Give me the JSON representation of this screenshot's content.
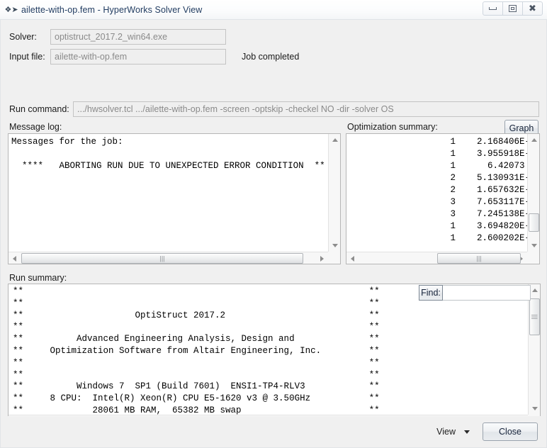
{
  "window": {
    "title": "ailette-with-op.fem - HyperWorks Solver View",
    "icon": "hyperworks-app-icon",
    "buttons": {
      "minimize": "minimize-icon",
      "maximize": "maximize-icon",
      "close": "close-icon"
    }
  },
  "form": {
    "solver_label": "Solver:",
    "solver_value": "optistruct_2017.2_win64.exe",
    "input_label": "Input file:",
    "input_value": "ailette-with-op.fem",
    "job_status": "Job completed",
    "run_command_label": "Run command:",
    "run_command_value": ".../hwsolver.tcl .../ailette-with-op.fem -screen -optskip -checkel NO -dir -solver OS"
  },
  "message_log": {
    "label": "Message log:",
    "text": "Messages for the job:\n\n  ****   ABORTING RUN DUE TO UNEXPECTED ERROR CONDITION  **"
  },
  "optimization_summary": {
    "label": "Optimization summary:",
    "graph_button": "Graph",
    "rows": [
      {
        "index": "1",
        "value": "2.168406E-"
      },
      {
        "index": "1",
        "value": "3.955918E-"
      },
      {
        "index": "1",
        "value": "  6.42073"
      },
      {
        "index": "2",
        "value": "5.130931E-"
      },
      {
        "index": "2",
        "value": "1.657632E-"
      },
      {
        "index": "3",
        "value": "7.653117E-"
      },
      {
        "index": "3",
        "value": "7.245138E-"
      },
      {
        "index": "1",
        "value": "3.694820E-"
      },
      {
        "index": "1",
        "value": "2.600202E-"
      }
    ],
    "text": "                   1    2.168406E-\n                   1    3.955918E-\n                   1      6.42073\n                   2    5.130931E-\n                   2    1.657632E-\n                   3    7.653117E-\n                   3    7.245138E-\n                   1    3.694820E-\n                   1    2.600202E-"
  },
  "run_summary": {
    "label": "Run summary:",
    "lines": [
      "**                                                                 **",
      "**                                                                 **",
      "**                     OptiStruct 2017.2                           **",
      "**                                                                 **",
      "**          Advanced Engineering Analysis, Design and              **",
      "**     Optimization Software from Altair Engineering, Inc.         **",
      "**                                                                 **",
      "**                                                                 **",
      "**          Windows 7  SP1 (Build 7601)  ENSI1-TP4-RLV3            **",
      "**     8 CPU:  Intel(R) Xeon(R) CPU E5-1620 v3 @ 3.50GHz           **",
      "**             28061 MB RAM,  65382 MB swap                        **",
      "**                                                                 **"
    ]
  },
  "find": {
    "button_label": "Find:",
    "value": "",
    "placeholder": ""
  },
  "footer": {
    "view_label": "View",
    "close_label": "Close"
  },
  "colors": {
    "window_bg": "#f0f0f0",
    "title_text": "#1f3a5f",
    "field_bg": "#efefef",
    "field_text": "#8a8a8a",
    "panel_bg": "#ffffff"
  }
}
